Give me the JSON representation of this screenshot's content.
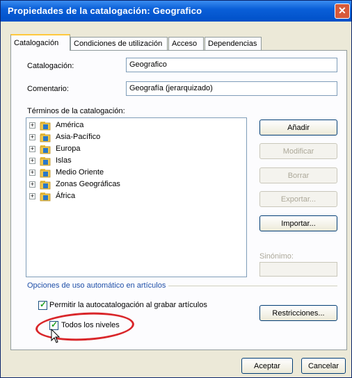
{
  "window": {
    "title": "Propiedades de la catalogación:  Geografico"
  },
  "tabs": [
    {
      "label": "Catalogación"
    },
    {
      "label": "Condiciones de utilización"
    },
    {
      "label": "Acceso"
    },
    {
      "label": "Dependencias"
    }
  ],
  "form": {
    "catalogacion_label": "Catalogación:",
    "catalogacion_value": "Geografico",
    "comentario_label": "Comentario:",
    "comentario_value": "Geografía (jerarquizado)",
    "terminos_label": "Términos de la catalogación:"
  },
  "tree": {
    "items": [
      {
        "label": "América"
      },
      {
        "label": "Asia-Pacífico"
      },
      {
        "label": "Europa"
      },
      {
        "label": "Islas"
      },
      {
        "label": "Medio Oriente"
      },
      {
        "label": "Zonas Geográficas"
      },
      {
        "label": "África"
      }
    ],
    "expander_glyph": "+",
    "folder_icon_color": "#f2c84b",
    "folder_book_color": "#2a78c8"
  },
  "buttons": {
    "anadir": "Añadir",
    "modificar": "Modificar",
    "borrar": "Borrar",
    "exportar": "Exportar...",
    "importar": "Importar...",
    "restricciones": "Restricciones...",
    "aceptar": "Aceptar",
    "cancelar": "Cancelar"
  },
  "sinonimo": {
    "label": "Sinónimo:",
    "value": ""
  },
  "options": {
    "group_title": "Opciones de uso automático en artículos",
    "auto_catalog_label": "Permitir la autocatalogación al grabar artículos",
    "auto_catalog_checked": true,
    "all_levels_label": "Todos los niveles",
    "all_levels_checked": true
  },
  "colors": {
    "title_bar": "#0a5fd8",
    "group_title": "#1f4fa8",
    "highlight_oval": "#d9262a"
  }
}
